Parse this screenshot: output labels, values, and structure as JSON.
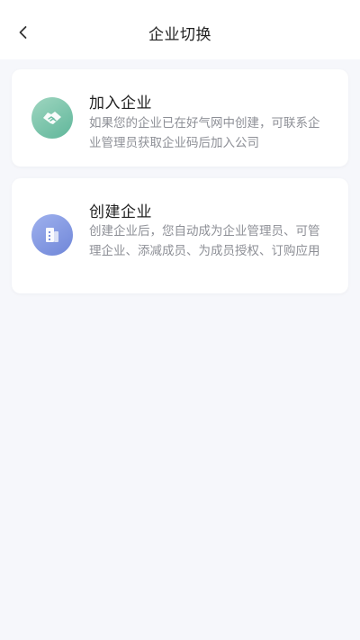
{
  "header": {
    "title": "企业切换",
    "back_icon": "chevron-left-icon"
  },
  "cards": [
    {
      "title": "加入企业",
      "description": "如果您的企业已在好气网中创建，可联系企业管理员获取企业码后加入公司",
      "icon": "handshake-icon",
      "icon_color": "#6cbea3"
    },
    {
      "title": "创建企业",
      "description": "创建企业后，您自动成为企业管理员、可管理企业、添减成员、为成员授权、订购应用",
      "icon": "building-icon",
      "icon_color": "#7b90dd"
    }
  ],
  "colors": {
    "background": "#f6f7fb",
    "card": "#ffffff",
    "description_text": "#8d8f96"
  }
}
